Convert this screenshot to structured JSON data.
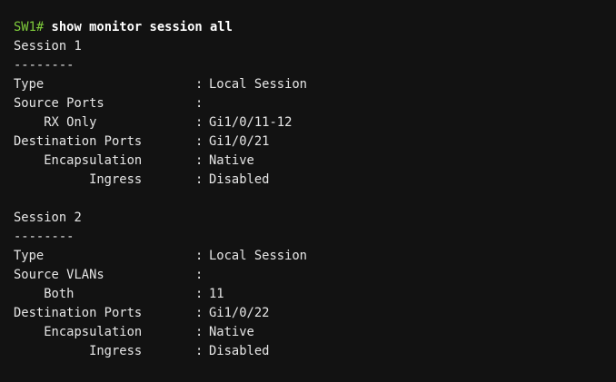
{
  "prompt": {
    "host": "SW1#",
    "command": "show monitor session all"
  },
  "lines": [
    {
      "kind": "heading",
      "text": "Session 1"
    },
    {
      "kind": "heading",
      "text": "--------"
    },
    {
      "kind": "kv",
      "label": "Type",
      "sep": ":",
      "value": "Local Session"
    },
    {
      "kind": "kv",
      "label": "Source Ports",
      "sep": ":",
      "value": ""
    },
    {
      "kind": "kv",
      "label": "    RX Only",
      "sep": ":",
      "value": "Gi1/0/11-12"
    },
    {
      "kind": "kv",
      "label": "Destination Ports",
      "sep": ":",
      "value": "Gi1/0/21"
    },
    {
      "kind": "kv",
      "label": "    Encapsulation",
      "sep": ":",
      "value": "Native"
    },
    {
      "kind": "kv",
      "label": "          Ingress",
      "sep": ":",
      "value": "Disabled"
    },
    {
      "kind": "blank",
      "text": ""
    },
    {
      "kind": "heading",
      "text": "Session 2"
    },
    {
      "kind": "heading",
      "text": "--------"
    },
    {
      "kind": "kv",
      "label": "Type",
      "sep": ":",
      "value": "Local Session"
    },
    {
      "kind": "kv",
      "label": "Source VLANs",
      "sep": ":",
      "value": ""
    },
    {
      "kind": "kv",
      "label": "    Both",
      "sep": ":",
      "value": "11"
    },
    {
      "kind": "kv",
      "label": "Destination Ports",
      "sep": ":",
      "value": "Gi1/0/22"
    },
    {
      "kind": "kv",
      "label": "    Encapsulation",
      "sep": ":",
      "value": "Native"
    },
    {
      "kind": "kv",
      "label": "          Ingress",
      "sep": ":",
      "value": "Disabled"
    }
  ]
}
